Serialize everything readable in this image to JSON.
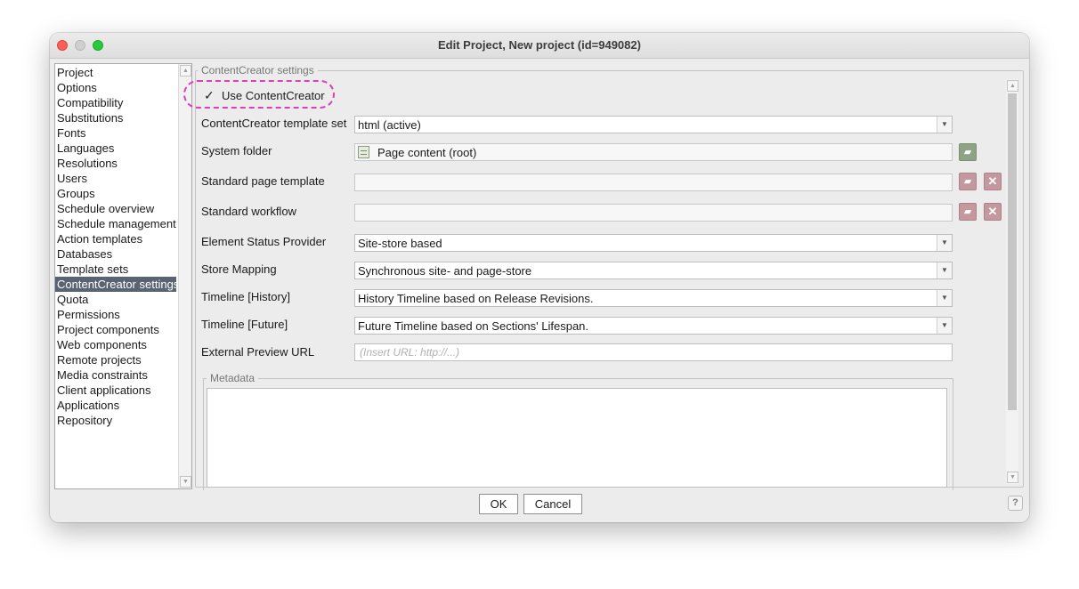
{
  "window": {
    "title": "Edit Project, New project (id=949082)"
  },
  "sidebar": {
    "items": [
      "Project",
      "Options",
      "Compatibility",
      "Substitutions",
      "Fonts",
      "Languages",
      "Resolutions",
      "Users",
      "Groups",
      "Schedule overview",
      "Schedule management",
      "Action templates",
      "Databases",
      "Template sets",
      "ContentCreator settings",
      "Quota",
      "Permissions",
      "Project components",
      "Web components",
      "Remote projects",
      "Media constraints",
      "Client applications",
      "Applications",
      "Repository"
    ],
    "selected": "ContentCreator settings"
  },
  "settings": {
    "group_title": "ContentCreator settings",
    "use_contentcreator": {
      "label": "Use ContentCreator",
      "checked": true,
      "mark": "✓"
    },
    "template_set": {
      "label": "ContentCreator template set",
      "value": "html (active)"
    },
    "system_folder": {
      "label": "System folder",
      "value": "Page content (root)"
    },
    "standard_page_template": {
      "label": "Standard page template",
      "value": ""
    },
    "standard_workflow": {
      "label": "Standard workflow",
      "value": ""
    },
    "element_status_provider": {
      "label": "Element Status Provider",
      "value": "Site-store based"
    },
    "store_mapping": {
      "label": "Store Mapping",
      "value": "Synchronous site- and page-store"
    },
    "timeline_history": {
      "label": "Timeline [History]",
      "value": "History Timeline based on Release Revisions."
    },
    "timeline_future": {
      "label": "Timeline [Future]",
      "value": "Future Timeline based on Sections' Lifespan."
    },
    "external_preview_url": {
      "label": "External Preview URL",
      "placeholder": "(Insert URL: http://...)"
    },
    "metadata": {
      "label": "Metadata"
    }
  },
  "buttons": {
    "ok": "OK",
    "cancel": "Cancel",
    "help": "?"
  },
  "colors": {
    "selection": "#5a6372",
    "highlight": "#de3fb6"
  }
}
